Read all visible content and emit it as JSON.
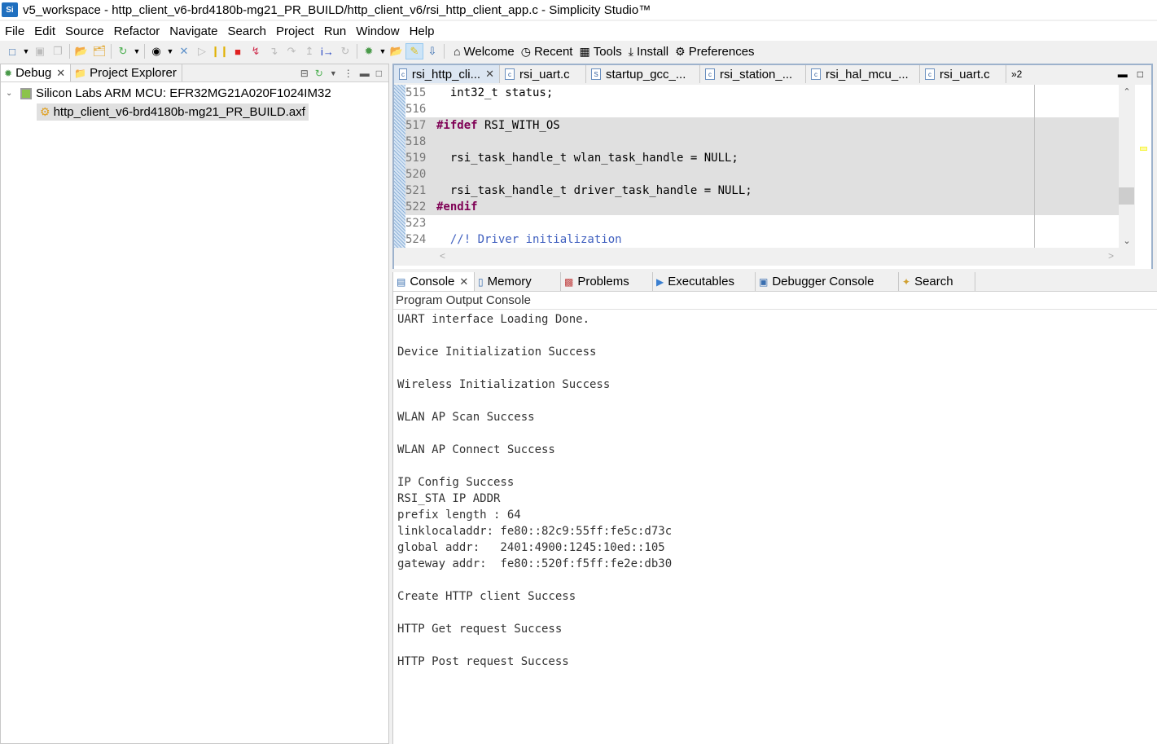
{
  "window": {
    "title": "v5_workspace - http_client_v6-brd4180b-mg21_PR_BUILD/http_client_v6/rsi_http_client_app.c - Simplicity Studio™",
    "logo": "Si"
  },
  "menu": [
    "File",
    "Edit",
    "Source",
    "Refactor",
    "Navigate",
    "Search",
    "Project",
    "Run",
    "Window",
    "Help"
  ],
  "toolbar": {
    "links": [
      {
        "icon": "home-icon",
        "label": "Welcome"
      },
      {
        "icon": "clock-icon",
        "label": "Recent"
      },
      {
        "icon": "grid-icon",
        "label": "Tools"
      },
      {
        "icon": "download-icon",
        "label": "Install"
      },
      {
        "icon": "gear-icon",
        "label": "Preferences"
      }
    ]
  },
  "left_panel": {
    "tabs": [
      {
        "label": "Debug",
        "active": true,
        "closable": true
      },
      {
        "label": "Project Explorer",
        "active": false
      }
    ],
    "tree": {
      "root": "Silicon Labs ARM MCU: EFR32MG21A020F1024IM32",
      "child": "http_client_v6-brd4180b-mg21_PR_BUILD.axf"
    }
  },
  "editor": {
    "tabs": [
      {
        "label": "rsi_http_cli...",
        "type": "c",
        "active": true
      },
      {
        "label": "rsi_uart.c",
        "type": "c"
      },
      {
        "label": "startup_gcc_...",
        "type": "s"
      },
      {
        "label": "rsi_station_...",
        "type": "c"
      },
      {
        "label": "rsi_hal_mcu_...",
        "type": "c"
      },
      {
        "label": "rsi_uart.c",
        "type": "c"
      }
    ],
    "overflow": "»2",
    "lines": [
      {
        "n": "515",
        "text": "  int32_t status;",
        "hl": false
      },
      {
        "n": "516",
        "text": "",
        "hl": false
      },
      {
        "n": "517",
        "kw": "#ifdef",
        "text": " RSI_WITH_OS",
        "hl": true
      },
      {
        "n": "518",
        "text": "",
        "hl": true
      },
      {
        "n": "519",
        "text": "  rsi_task_handle_t wlan_task_handle = NULL;",
        "hl": true
      },
      {
        "n": "520",
        "text": "",
        "hl": true
      },
      {
        "n": "521",
        "text": "  rsi_task_handle_t driver_task_handle = NULL;",
        "hl": true
      },
      {
        "n": "522",
        "kw": "#endif",
        "text": "",
        "hl": true
      },
      {
        "n": "523",
        "text": "",
        "hl": false
      },
      {
        "n": "524",
        "comment": "  //! Driver initialization",
        "hl": false
      }
    ]
  },
  "console": {
    "tabs": [
      {
        "icon": "console-icon",
        "label": "Console",
        "active": true
      },
      {
        "icon": "memory-icon",
        "label": "Memory"
      },
      {
        "icon": "problems-icon",
        "label": "Problems"
      },
      {
        "icon": "executables-icon",
        "label": "Executables"
      },
      {
        "icon": "debugger-console-icon",
        "label": "Debugger Console"
      },
      {
        "icon": "search-icon",
        "label": "Search"
      }
    ],
    "subtitle": "Program Output Console",
    "output": [
      "UART interface Loading Done.",
      "",
      "Device Initialization Success",
      "",
      "Wireless Initialization Success",
      "",
      "WLAN AP Scan Success",
      "",
      "WLAN AP Connect Success",
      "",
      "IP Config Success",
      "RSI_STA IP ADDR",
      "prefix length : 64",
      "linklocaladdr: fe80::82c9:55ff:fe5c:d73c",
      "global addr:   2401:4900:1245:10ed::105",
      "gateway addr:  fe80::520f:f5ff:fe2e:db30",
      "",
      "Create HTTP client Success",
      "",
      "HTTP Get request Success",
      "",
      "HTTP Post request Success"
    ]
  }
}
